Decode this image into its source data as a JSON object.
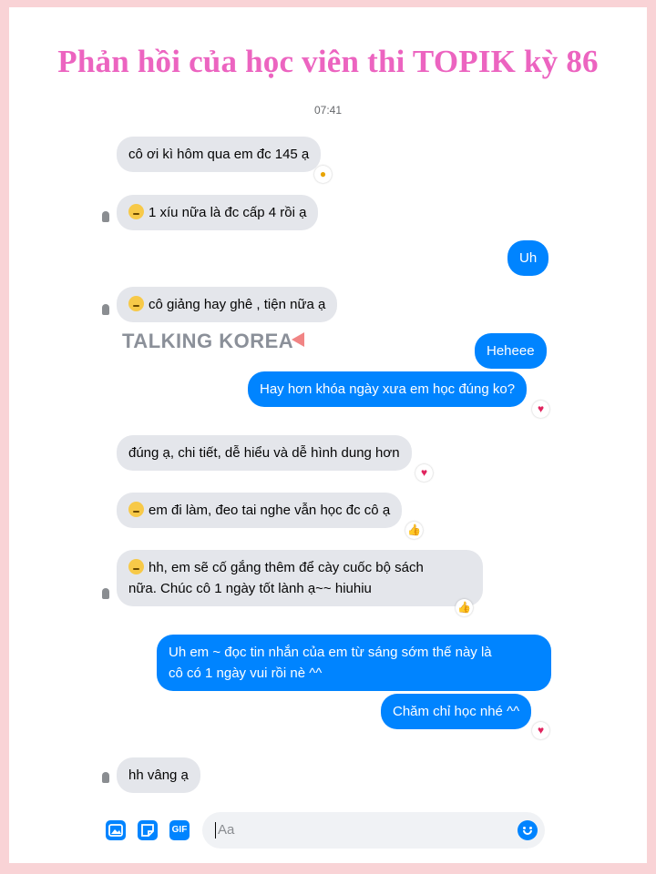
{
  "headline": "Phản hồi của học viên thi TOPIK kỳ 86",
  "timestamp": "07:41",
  "watermark": "TALKING KOREA",
  "messages": [
    {
      "text": "cô ơi kì hôm qua em đc 145 ạ",
      "from": "student",
      "reaction": "wow"
    },
    {
      "text": "1 xíu nữa là đc cấp 4 rồi ạ",
      "from": "student",
      "emoji": "confused"
    },
    {
      "text": "Uh",
      "from": "teacher"
    },
    {
      "text": "cô giảng hay ghê , tiện nữa ạ",
      "from": "student",
      "emoji": "smile"
    },
    {
      "text": "Heheee",
      "from": "teacher"
    },
    {
      "text": "Hay hơn khóa ngày xưa em học đúng ko?",
      "from": "teacher",
      "reaction": "heart"
    },
    {
      "text": "đúng ạ, chi tiết, dễ hiểu và dễ hình dung hơn",
      "from": "student",
      "reaction": "heart"
    },
    {
      "text": "em đi làm, đeo tai nghe vẫn học đc cô ạ",
      "from": "student",
      "emoji": "smile",
      "reaction": "thumbs-up"
    },
    {
      "line1": "hh, em sẽ cố gắng thêm để cày cuốc bộ sách",
      "line2": "nữa. Chúc cô 1 ngày tốt lành ạ~~ hiuhiu",
      "from": "student",
      "emoji": "smile",
      "reaction": "thumbs-up"
    },
    {
      "line1": "Uh em ~ đọc tin nhắn của em từ sáng sớm thế này là",
      "line2": "cô có 1 ngày vui rồi nè ^^",
      "from": "teacher"
    },
    {
      "text": "Chăm chỉ học nhé ^^",
      "from": "teacher",
      "reaction": "heart"
    },
    {
      "text": "hh vâng ạ",
      "from": "student"
    }
  ],
  "composer": {
    "placeholder": "Aa",
    "gif_label": "GIF",
    "icons": [
      "image-icon",
      "sticker-icon",
      "gif-icon",
      "emoji-icon"
    ]
  },
  "colors": {
    "background": "#f9d3d6",
    "headline": "#ec64c0",
    "sent_bubble": "#0084ff",
    "received_bubble": "#e4e6eb"
  }
}
